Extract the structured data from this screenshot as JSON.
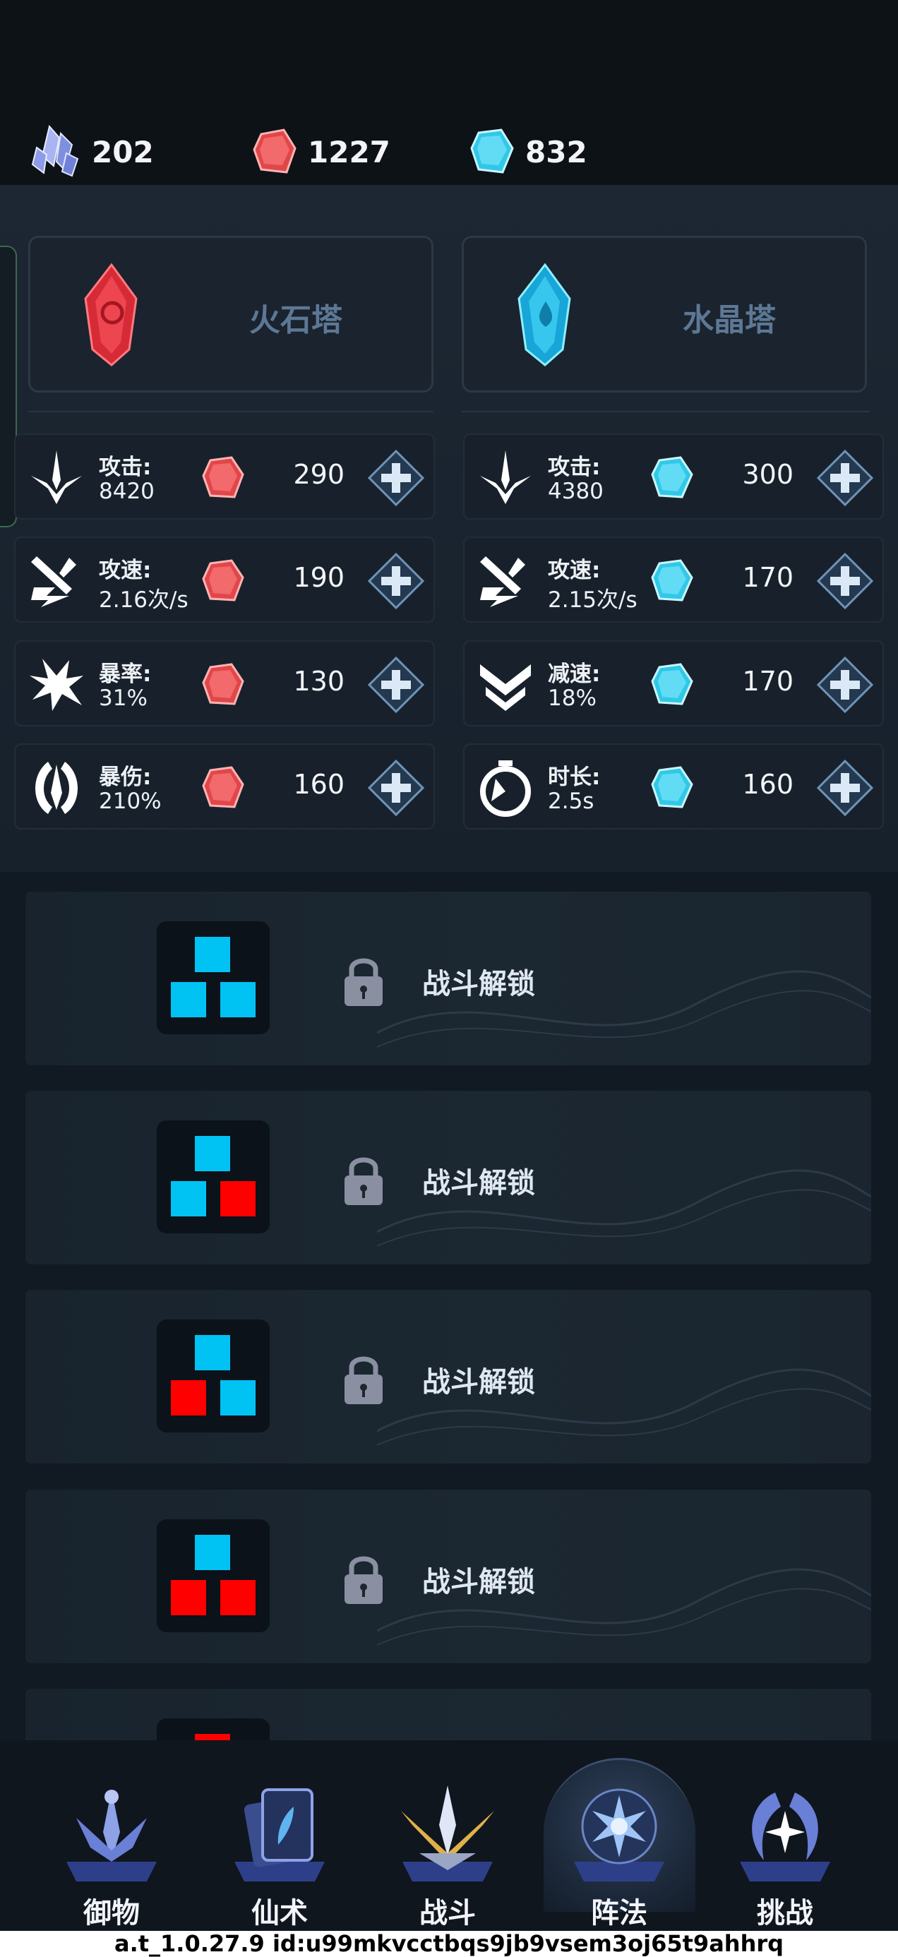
{
  "currencies": [
    {
      "icon": "purple-crystal-cluster-icon",
      "value": "202"
    },
    {
      "icon": "red-gem-icon",
      "value": "1227"
    },
    {
      "icon": "blue-gem-icon",
      "value": "832"
    }
  ],
  "towers": [
    {
      "name": "火石塔",
      "icon": "red-crystal-icon"
    },
    {
      "name": "水晶塔",
      "icon": "blue-crystal-icon"
    }
  ],
  "fire_stats": [
    {
      "label": "攻击:",
      "value": "8420",
      "cost": "290",
      "icon": "sword-icon"
    },
    {
      "label": "攻速:",
      "value": "2.16次/s",
      "cost": "190",
      "icon": "attack-speed-icon"
    },
    {
      "label": "暴率:",
      "value": "31%",
      "cost": "130",
      "icon": "crit-rate-icon"
    },
    {
      "label": "暴伤:",
      "value": "210%",
      "cost": "160",
      "icon": "crit-damage-icon"
    }
  ],
  "water_stats": [
    {
      "label": "攻击:",
      "value": "4380",
      "cost": "300",
      "icon": "sword-icon"
    },
    {
      "label": "攻速:",
      "value": "2.15次/s",
      "cost": "170",
      "icon": "attack-speed-icon"
    },
    {
      "label": "减速:",
      "value": "18%",
      "cost": "170",
      "icon": "slow-chevron-icon"
    },
    {
      "label": "时长:",
      "value": "2.5s",
      "cost": "160",
      "icon": "stopwatch-icon"
    }
  ],
  "lock_rows": [
    {
      "text": "战斗解锁",
      "pattern": [
        "blue",
        "blue",
        "blue"
      ]
    },
    {
      "text": "战斗解锁",
      "pattern": [
        "blue",
        "blue",
        "red"
      ]
    },
    {
      "text": "战斗解锁",
      "pattern": [
        "blue",
        "red",
        "blue"
      ]
    },
    {
      "text": "战斗解锁",
      "pattern": [
        "blue",
        "red",
        "red"
      ]
    },
    {
      "text": "",
      "pattern": [
        "red",
        "",
        ""
      ]
    }
  ],
  "nav": [
    {
      "label": "御物",
      "icon": "swords-emblem-icon",
      "active": false
    },
    {
      "label": "仙术",
      "icon": "spell-card-icon",
      "active": false
    },
    {
      "label": "战斗",
      "icon": "crossed-weapons-icon",
      "active": false
    },
    {
      "label": "阵法",
      "icon": "formation-snowflake-icon",
      "active": true
    },
    {
      "label": "挑战",
      "icon": "challenge-wings-icon",
      "active": false
    }
  ],
  "footer_text": "a.t_1.0.27.9 id:u99mkvcctbqs9jb9vsem3oj65t9ahhrq",
  "colors": {
    "red_gem": "#e0474a",
    "blue_gem": "#31c8e8",
    "tile_blue": "#00c3f4",
    "tile_red": "#ff0000",
    "tower_label": "#5d7895"
  }
}
